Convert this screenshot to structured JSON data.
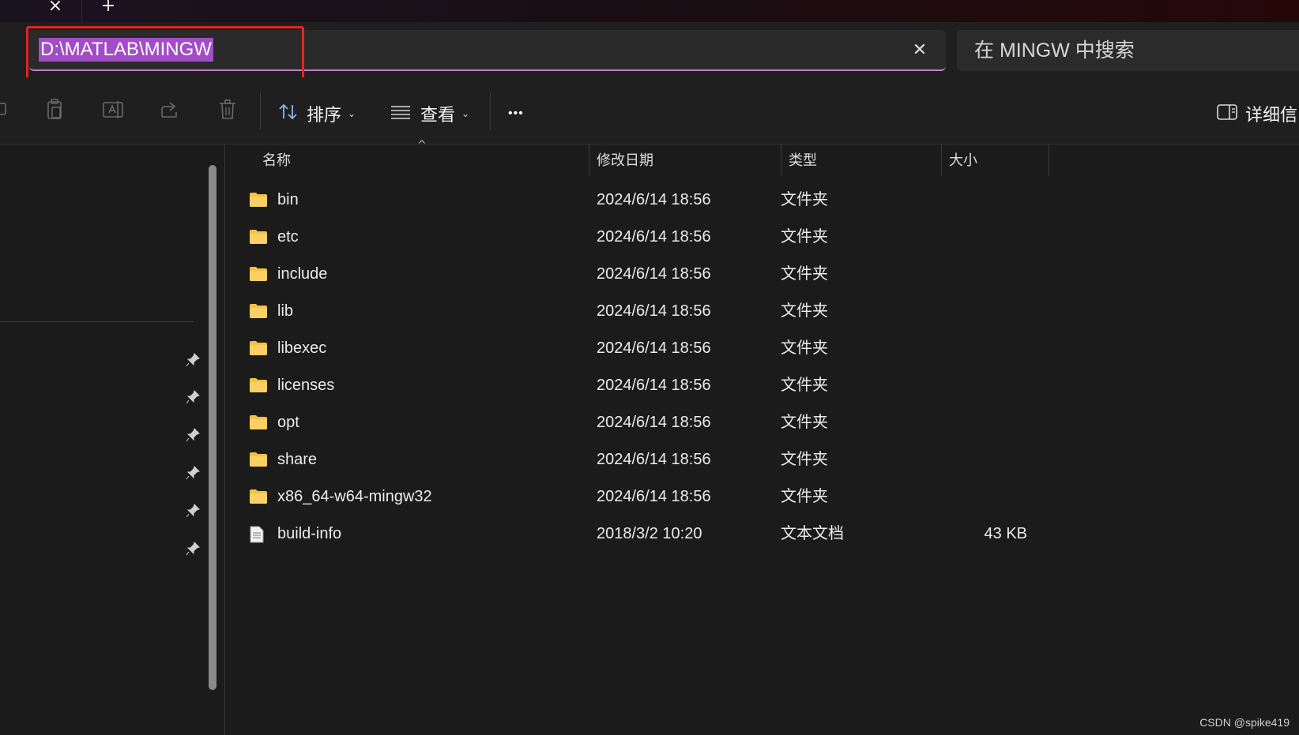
{
  "tabs": {
    "close_glyph": "×",
    "add_glyph": "+"
  },
  "address": {
    "path": "D:\\MATLAB\\MINGW",
    "clear_glyph": "✕"
  },
  "search": {
    "placeholder": "在 MINGW 中搜索"
  },
  "toolbar": {
    "sort_label": "排序",
    "view_label": "查看",
    "more_label": "•••",
    "details_label": "详细信"
  },
  "columns": {
    "name": "名称",
    "modified": "修改日期",
    "type": "类型",
    "size": "大小"
  },
  "files": [
    {
      "name": "bin",
      "modified": "2024/6/14 18:56",
      "type": "文件夹",
      "size": "",
      "icon": "folder-icon"
    },
    {
      "name": "etc",
      "modified": "2024/6/14 18:56",
      "type": "文件夹",
      "size": "",
      "icon": "folder-icon"
    },
    {
      "name": "include",
      "modified": "2024/6/14 18:56",
      "type": "文件夹",
      "size": "",
      "icon": "folder-icon"
    },
    {
      "name": "lib",
      "modified": "2024/6/14 18:56",
      "type": "文件夹",
      "size": "",
      "icon": "folder-icon"
    },
    {
      "name": "libexec",
      "modified": "2024/6/14 18:56",
      "type": "文件夹",
      "size": "",
      "icon": "folder-icon"
    },
    {
      "name": "licenses",
      "modified": "2024/6/14 18:56",
      "type": "文件夹",
      "size": "",
      "icon": "folder-icon"
    },
    {
      "name": "opt",
      "modified": "2024/6/14 18:56",
      "type": "文件夹",
      "size": "",
      "icon": "folder-icon"
    },
    {
      "name": "share",
      "modified": "2024/6/14 18:56",
      "type": "文件夹",
      "size": "",
      "icon": "folder-icon"
    },
    {
      "name": "x86_64-w64-mingw32",
      "modified": "2024/6/14 18:56",
      "type": "文件夹",
      "size": "",
      "icon": "folder-icon"
    },
    {
      "name": "build-info",
      "modified": "2018/3/2 10:20",
      "type": "文本文档",
      "size": "43 KB",
      "icon": "text-document-icon"
    }
  ],
  "watermark": "CSDN @spike419",
  "colors": {
    "accent": "#a24cc7",
    "highlight_box": "#e8231d",
    "folder": "#f4c142"
  }
}
